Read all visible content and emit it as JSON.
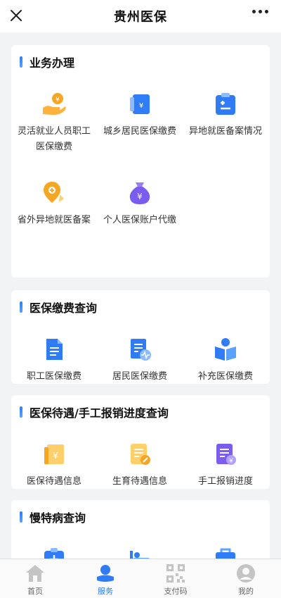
{
  "header": {
    "title": "贵州医保"
  },
  "sections": [
    {
      "title": "业务办理",
      "items": [
        {
          "label": "灵活就业人员职工医保缴费",
          "icon": "hand-coin-icon"
        },
        {
          "label": "城乡居民医保缴费",
          "icon": "wallet-card-icon"
        },
        {
          "label": "异地就医备案情况",
          "icon": "medical-clipboard-icon"
        },
        {
          "label": "省外异地就医备案",
          "icon": "location-pin-icon"
        },
        {
          "label": "个人医保账户代缴",
          "icon": "money-bag-icon"
        }
      ]
    },
    {
      "title": "医保缴费查询",
      "items": [
        {
          "label": "职工医保缴费",
          "icon": "document-icon"
        },
        {
          "label": "居民医保缴费",
          "icon": "document-pulse-icon"
        },
        {
          "label": "补充医保缴费",
          "icon": "book-reader-icon"
        }
      ]
    },
    {
      "title": "医保待遇/手工报销进度查询",
      "items": [
        {
          "label": "医保待遇信息",
          "icon": "yuan-receipt-icon"
        },
        {
          "label": "生育待遇信息",
          "icon": "edit-note-icon"
        },
        {
          "label": "手工报销进度",
          "icon": "reimbursement-icon"
        }
      ]
    },
    {
      "title": "慢特病查询",
      "items": []
    }
  ],
  "tabbar": [
    {
      "label": "首页",
      "icon": "home-icon"
    },
    {
      "label": "服务",
      "icon": "service-icon"
    },
    {
      "label": "支付码",
      "icon": "qr-code-icon"
    },
    {
      "label": "我的",
      "icon": "user-icon"
    }
  ],
  "colors": {
    "accent": "#2f7cf6",
    "orange": "#f5a623",
    "purple": "#7b5cf0"
  }
}
